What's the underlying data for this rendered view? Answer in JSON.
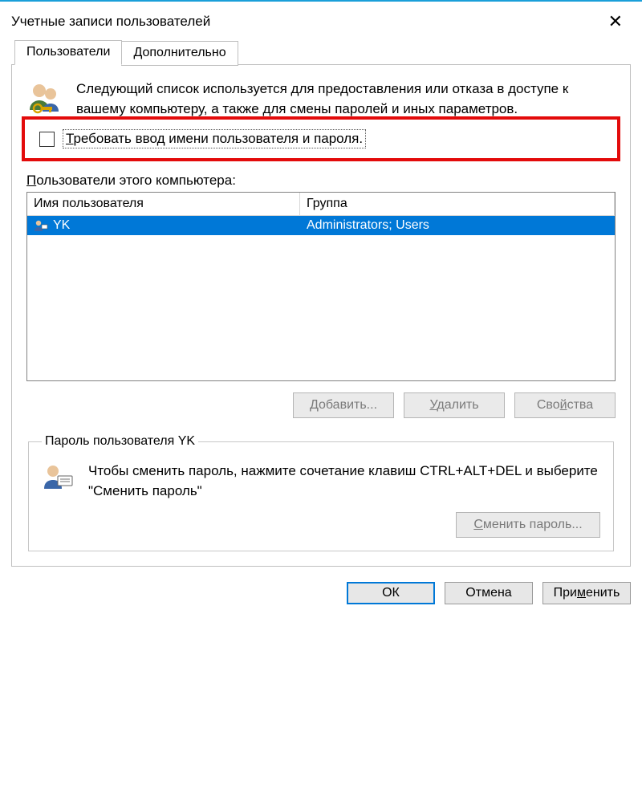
{
  "window": {
    "title": "Учетные записи пользователей"
  },
  "tabs": {
    "users": "Пользователи",
    "advanced": "Дополнительно"
  },
  "intro": "Следующий список используется для предоставления или отказа в доступе к вашему компьютеру, а также для смены паролей и иных параметров.",
  "require_credentials": {
    "label": "Требовать ввод имени пользователя и пароля.",
    "checked": false
  },
  "users_section": {
    "label": "Пользователи этого компьютера:",
    "columns": {
      "name": "Имя пользователя",
      "group": "Группа"
    },
    "rows": [
      {
        "name": "YK",
        "group": "Administrators; Users"
      }
    ]
  },
  "buttons": {
    "add": "Добавить...",
    "remove": "Удалить",
    "properties": "Свойства"
  },
  "password_section": {
    "legend": "Пароль пользователя YK",
    "text": "Чтобы сменить пароль, нажмите сочетание клавиш CTRL+ALT+DEL и выберите \"Сменить пароль\"",
    "button": "Сменить пароль..."
  },
  "dialog_buttons": {
    "ok": "ОК",
    "cancel": "Отмена",
    "apply": "Применить"
  }
}
